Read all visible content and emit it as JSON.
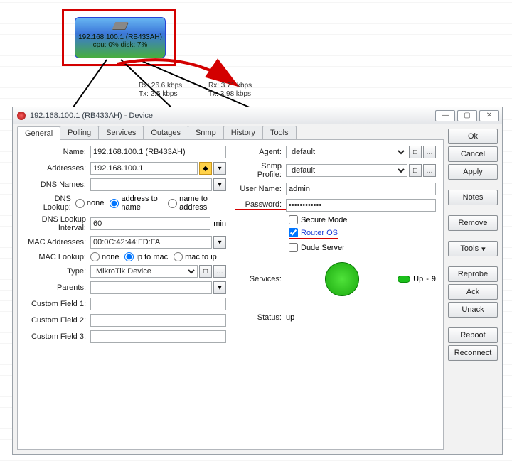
{
  "map": {
    "device": {
      "label": "192.168.100.1 (RB433AH)",
      "stats": "cpu: 0% disk: 7%"
    },
    "link1": {
      "rx": "Rx: 26.6 kbps",
      "tx": "Tx: 2.5 kbps"
    },
    "link2": {
      "rx": "Rx: 3.71 kbps",
      "tx": "Tx: 3.98 kbps"
    }
  },
  "dialog": {
    "title": "192.168.100.1 (RB433AH) - Device",
    "tabs": [
      "General",
      "Polling",
      "Services",
      "Outages",
      "Snmp",
      "History",
      "Tools"
    ]
  },
  "left": {
    "name": {
      "label": "Name:",
      "value": "192.168.100.1 (RB433AH)"
    },
    "addresses": {
      "label": "Addresses:",
      "value": "192.168.100.1"
    },
    "dnsnames": {
      "label": "DNS Names:",
      "value": ""
    },
    "dnslookup": {
      "label": "DNS Lookup:",
      "opt_none": "none",
      "opt_a2n": "address to name",
      "opt_n2a": "name to address"
    },
    "dnsinterval": {
      "label": "DNS Lookup Interval:",
      "value": "60",
      "unit": "min"
    },
    "mac": {
      "label": "MAC Addresses:",
      "value": "00:0C:42:44:FD:FA"
    },
    "maclookup": {
      "label": "MAC Lookup:",
      "opt_none": "none",
      "opt_i2m": "ip to mac",
      "opt_m2i": "mac to ip"
    },
    "type": {
      "label": "Type:",
      "value": "MikroTik Device"
    },
    "parents": {
      "label": "Parents:",
      "value": ""
    },
    "cf1": {
      "label": "Custom Field 1:",
      "value": ""
    },
    "cf2": {
      "label": "Custom Field 2:",
      "value": ""
    },
    "cf3": {
      "label": "Custom Field 3:",
      "value": ""
    }
  },
  "right": {
    "agent": {
      "label": "Agent:",
      "value": "default"
    },
    "snmp": {
      "label": "Snmp Profile:",
      "value": "default"
    },
    "user": {
      "label": "User Name:",
      "value": "admin"
    },
    "pass": {
      "label": "Password:",
      "value": "••••••••••••"
    },
    "secure": "Secure Mode",
    "ros": "Router OS",
    "dude": "Dude Server",
    "services": {
      "label": "Services:",
      "state": "Up",
      "count": "9",
      "sep": "-"
    },
    "status": {
      "label": "Status:",
      "value": "up"
    }
  },
  "buttons": {
    "ok": "Ok",
    "cancel": "Cancel",
    "apply": "Apply",
    "notes": "Notes",
    "remove": "Remove",
    "tools": "Tools",
    "reprobe": "Reprobe",
    "ack": "Ack",
    "unack": "Unack",
    "reboot": "Reboot",
    "reconnect": "Reconnect"
  }
}
